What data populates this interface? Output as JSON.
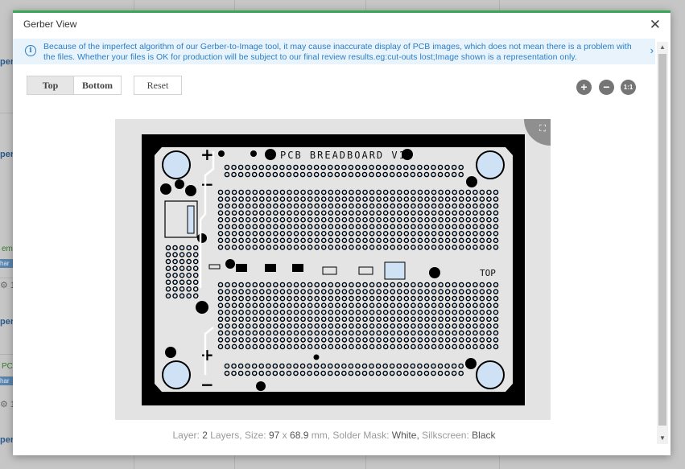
{
  "modal": {
    "title": "Gerber View",
    "close_glyph": "✕"
  },
  "notice": {
    "icon": "info-icon",
    "text": "Because of the imperfect algorithm of our Gerber-to-Image tool, it may cause inaccurate display of PCB images, which does not mean there is a problem with the files. Whether your files is OK for production will be subject to our final review results.eg:cut-outs lost;Image shown is a representation only.",
    "arrow": "›"
  },
  "side_buttons": {
    "top": "Top",
    "bottom": "Bottom",
    "active": "Top"
  },
  "reset_label": "Reset",
  "zoom": {
    "in": "+",
    "out": "−",
    "reset": "1:1"
  },
  "board": {
    "silkscreen_title": "PCB BREADBOARD V1",
    "side_label": "TOP",
    "plus_glyph": "+",
    "minus_glyph": "−"
  },
  "layer_info": {
    "layer_label": "Layer:",
    "layer_value": "2",
    "layer_unit": "Layers,",
    "size_label": "Size:",
    "size_w": "97",
    "size_x": "x",
    "size_h": "68.9",
    "size_unit": "mm,",
    "mask_label": "Solder Mask:",
    "mask_value": "White,",
    "silk_label": "Silkscreen:",
    "silk_value": "Black"
  },
  "background": {
    "fragments": [
      "per",
      "per",
      "per",
      "per",
      "per"
    ],
    "green_texts": [
      "em",
      "PC"
    ],
    "chip_texts": [
      "har",
      "har"
    ],
    "gear_texts": [
      "⚙ 1",
      "⚙ 1"
    ]
  },
  "colors": {
    "accent": "#3aa757",
    "notice_text": "#2b7fc5",
    "pcb_mask": "#e4e4e4",
    "pcb_frame": "#000000",
    "pad_ring": "#000000",
    "pad_fill": "#cfe2f5"
  }
}
